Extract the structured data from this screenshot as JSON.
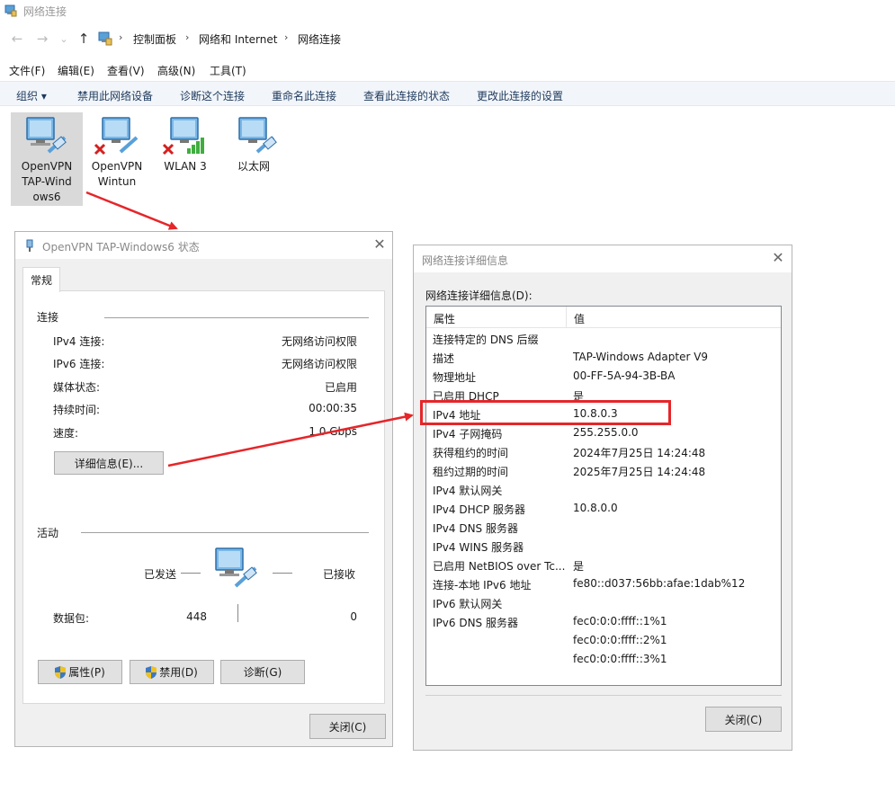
{
  "window": {
    "title": "网络连接"
  },
  "address_bar": {
    "back": "←",
    "forward": "→",
    "recent": "⌄",
    "up": "↑",
    "crumbs": [
      "控制面板",
      "网络和 Internet",
      "网络连接"
    ]
  },
  "menu": [
    "文件(F)",
    "编辑(E)",
    "查看(V)",
    "高级(N)",
    "工具(T)"
  ],
  "toolbar": {
    "organize": "组织 ▾",
    "items": [
      "禁用此网络设备",
      "诊断这个连接",
      "重命名此连接",
      "查看此连接的状态",
      "更改此连接的设置"
    ]
  },
  "adapters": [
    {
      "label": "OpenVPN TAP-Windows6",
      "label_lines": [
        "OpenVPN",
        "TAP-Wind",
        "ows6"
      ],
      "status": "connected",
      "selected": true
    },
    {
      "label": "OpenVPN Wintun",
      "label_lines": [
        "OpenVPN",
        "Wintun"
      ],
      "status": "disconnected",
      "selected": false
    },
    {
      "label": "WLAN 3",
      "label_lines": [
        "WLAN 3"
      ],
      "status": "disconnected",
      "selected": false
    },
    {
      "label": "以太网",
      "label_lines": [
        "以太网"
      ],
      "status": "connected",
      "selected": false
    }
  ],
  "status_dialog": {
    "title": "OpenVPN TAP-Windows6 状态",
    "close_glyph": "✕",
    "tab": "常规",
    "connection_group": "连接",
    "fields": [
      {
        "label": "IPv4 连接:",
        "value": "无网络访问权限"
      },
      {
        "label": "IPv6 连接:",
        "value": "无网络访问权限"
      },
      {
        "label": "媒体状态:",
        "value": "已启用"
      },
      {
        "label": "持续时间:",
        "value": "00:00:35"
      },
      {
        "label": "速度:",
        "value": "1.0 Gbps"
      }
    ],
    "details_button": "详细信息(E)...",
    "activity_group": "活动",
    "sent_label": "已发送",
    "received_label": "已接收",
    "packets_label": "数据包:",
    "packets_sent": "448",
    "packets_received": "0",
    "properties_button": "属性(P)",
    "disable_button": "禁用(D)",
    "diagnose_button": "诊断(G)",
    "close_button": "关闭(C)"
  },
  "details_dialog": {
    "title": "网络连接详细信息",
    "close_glyph": "✕",
    "list_label": "网络连接详细信息(D):",
    "col_property": "属性",
    "col_value": "值",
    "rows": [
      {
        "p": "连接特定的 DNS 后缀",
        "v": ""
      },
      {
        "p": "描述",
        "v": "TAP-Windows Adapter V9"
      },
      {
        "p": "物理地址",
        "v": "00-FF-5A-94-3B-BA"
      },
      {
        "p": "已启用 DHCP",
        "v": "是"
      },
      {
        "p": "IPv4 地址",
        "v": "10.8.0.3"
      },
      {
        "p": "IPv4 子网掩码",
        "v": "255.255.0.0"
      },
      {
        "p": "获得租约的时间",
        "v": "2024年7月25日 14:24:48"
      },
      {
        "p": "租约过期的时间",
        "v": "2025年7月25日 14:24:48"
      },
      {
        "p": "IPv4 默认网关",
        "v": ""
      },
      {
        "p": "IPv4 DHCP 服务器",
        "v": "10.8.0.0"
      },
      {
        "p": "IPv4 DNS 服务器",
        "v": ""
      },
      {
        "p": "IPv4 WINS 服务器",
        "v": ""
      },
      {
        "p": "已启用 NetBIOS over Tc...",
        "v": "是"
      },
      {
        "p": "连接-本地 IPv6 地址",
        "v": "fe80::d037:56bb:afae:1dab%12"
      },
      {
        "p": "IPv6 默认网关",
        "v": ""
      },
      {
        "p": "IPv6 DNS 服务器",
        "v": "fec0:0:0:ffff::1%1"
      },
      {
        "p": "",
        "v": "fec0:0:0:ffff::2%1"
      },
      {
        "p": "",
        "v": "fec0:0:0:ffff::3%1"
      }
    ],
    "close_button": "关闭(C)"
  },
  "colors": {
    "annotation": "#e5262a",
    "toolbar_bg": "#f2f6fb",
    "dialog_bg": "#f0f0f0"
  }
}
